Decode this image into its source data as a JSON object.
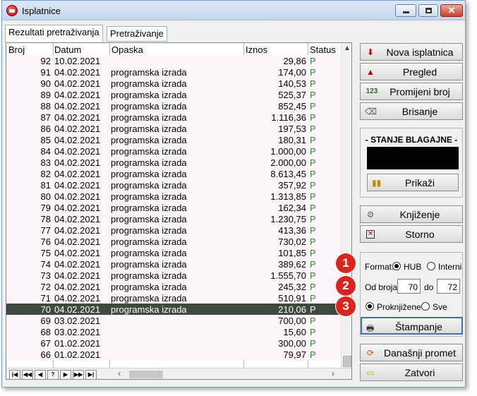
{
  "window": {
    "title": "Isplatnice",
    "controls": {
      "minimize": "minimize",
      "maximize": "maximize",
      "close": "✕"
    }
  },
  "tabs": [
    {
      "label": "Rezultati pretraživanja",
      "active": true
    },
    {
      "label": "Pretraživanje",
      "active": false
    }
  ],
  "grid": {
    "columns": {
      "broj": "Broj",
      "datum": "Datum",
      "opaska": "Opaska",
      "iznos": "Iznos",
      "status": "Status"
    },
    "rows": [
      {
        "broj": "92",
        "datum": "10.02.2021",
        "opaska": "",
        "iznos": "29,86",
        "status": "P"
      },
      {
        "broj": "91",
        "datum": "04.02.2021",
        "opaska": "programska izrada",
        "iznos": "174,00",
        "status": "P"
      },
      {
        "broj": "90",
        "datum": "04.02.2021",
        "opaska": "programska izrada",
        "iznos": "140,53",
        "status": "P"
      },
      {
        "broj": "89",
        "datum": "04.02.2021",
        "opaska": "programska izrada",
        "iznos": "525,37",
        "status": "P"
      },
      {
        "broj": "88",
        "datum": "04.02.2021",
        "opaska": "programska izrada",
        "iznos": "852,45",
        "status": "P"
      },
      {
        "broj": "87",
        "datum": "04.02.2021",
        "opaska": "programska izrada",
        "iznos": "1.116,36",
        "status": "P"
      },
      {
        "broj": "86",
        "datum": "04.02.2021",
        "opaska": "programska izrada",
        "iznos": "197,53",
        "status": "P"
      },
      {
        "broj": "85",
        "datum": "04.02.2021",
        "opaska": "programska izrada",
        "iznos": "180,31",
        "status": "P"
      },
      {
        "broj": "84",
        "datum": "04.02.2021",
        "opaska": "programska izrada",
        "iznos": "1.000,00",
        "status": "P"
      },
      {
        "broj": "83",
        "datum": "04.02.2021",
        "opaska": "programska izrada",
        "iznos": "2.000,00",
        "status": "P"
      },
      {
        "broj": "82",
        "datum": "04.02.2021",
        "opaska": "programska izrada",
        "iznos": "8.613,45",
        "status": "P"
      },
      {
        "broj": "81",
        "datum": "04.02.2021",
        "opaska": "programska izrada",
        "iznos": "357,92",
        "status": "P"
      },
      {
        "broj": "80",
        "datum": "04.02.2021",
        "opaska": "programska izrada",
        "iznos": "1.313,85",
        "status": "P"
      },
      {
        "broj": "79",
        "datum": "04.02.2021",
        "opaska": "programska izrada",
        "iznos": "162,34",
        "status": "P"
      },
      {
        "broj": "78",
        "datum": "04.02.2021",
        "opaska": "programska izrada",
        "iznos": "1.230,75",
        "status": "P"
      },
      {
        "broj": "77",
        "datum": "04.02.2021",
        "opaska": "programska izrada",
        "iznos": "413,36",
        "status": "P"
      },
      {
        "broj": "76",
        "datum": "04.02.2021",
        "opaska": "programska izrada",
        "iznos": "730,02",
        "status": "P"
      },
      {
        "broj": "75",
        "datum": "04.02.2021",
        "opaska": "programska izrada",
        "iznos": "101,85",
        "status": "P"
      },
      {
        "broj": "74",
        "datum": "04.02.2021",
        "opaska": "programska izrada",
        "iznos": "389,62",
        "status": "P"
      },
      {
        "broj": "73",
        "datum": "04.02.2021",
        "opaska": "programska izrada",
        "iznos": "1.555,70",
        "status": "P"
      },
      {
        "broj": "72",
        "datum": "04.02.2021",
        "opaska": "programska izrada",
        "iznos": "245,32",
        "status": "P"
      },
      {
        "broj": "71",
        "datum": "04.02.2021",
        "opaska": "programska izrada",
        "iznos": "510,91",
        "status": "P"
      },
      {
        "broj": "70",
        "datum": "04.02.2021",
        "opaska": "programska izrada",
        "iznos": "210,06",
        "status": "P",
        "selected": true
      },
      {
        "broj": "69",
        "datum": "03.02.2021",
        "opaska": "",
        "iznos": "700,00",
        "status": "P"
      },
      {
        "broj": "68",
        "datum": "03.02.2021",
        "opaska": "",
        "iznos": "15,60",
        "status": "P"
      },
      {
        "broj": "67",
        "datum": "01.02.2021",
        "opaska": "",
        "iznos": "300,00",
        "status": "P"
      },
      {
        "broj": "66",
        "datum": "01.02.2021",
        "opaska": "",
        "iznos": "79,97",
        "status": "P"
      }
    ],
    "navigator": [
      "|◀",
      "◀◀",
      "◀",
      "?",
      "▶",
      "▶▶",
      "▶|"
    ]
  },
  "actions": {
    "nova": "Nova isplatnica",
    "pregled": "Pregled",
    "promijeni": "Promijeni broj",
    "brisanje": "Brisanje",
    "knjizenje": "Knjiženje",
    "storno": "Storno",
    "stampanje": "Štampanje",
    "danasnji": "Današnji promet",
    "zatvori": "Zatvori"
  },
  "balance": {
    "title": "- STANJE BLAGAJNE -",
    "value": "",
    "show_label": "Prikaži"
  },
  "print_options": {
    "format_label": "Format:",
    "format_hub": "HUB",
    "format_interni": "Interni",
    "format_selected": "HUB",
    "od_broja_label": "Od broja:",
    "od_value": "70",
    "do_label": "do",
    "do_value": "72",
    "proknjizene": "Proknjižene",
    "sve": "Sve",
    "filter_selected": "Proknjižene"
  },
  "badges": [
    "1",
    "2",
    "3"
  ],
  "icons": {
    "nova": "down-arrow-plus-icon",
    "pregled": "warning-triangle-icon",
    "promijeni": "123-icon",
    "brisanje": "eraser-icon",
    "prikazi": "bar-chart-icon",
    "knjizenje": "gear-icon",
    "storno": "cancel-box-icon",
    "stampanje": "printer-icon",
    "danasnji": "refresh-icon",
    "zatvori": "folder-icon"
  }
}
